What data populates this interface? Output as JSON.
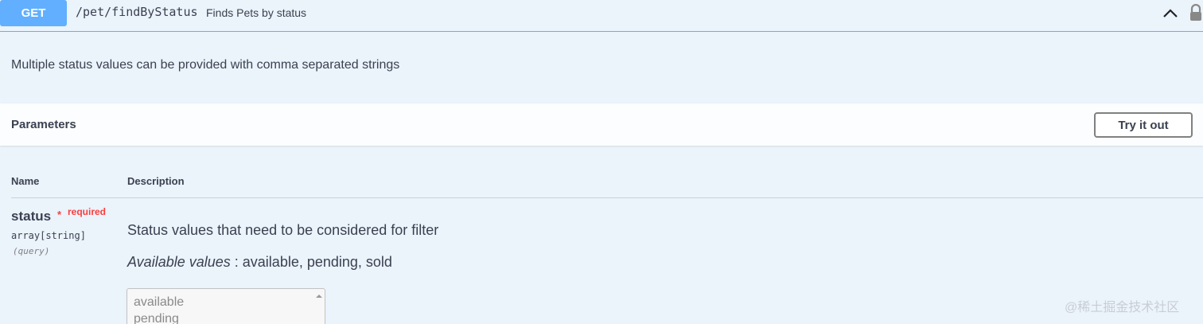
{
  "operation": {
    "method": "GET",
    "path": "/pet/findByStatus",
    "summary": "Finds Pets by status",
    "description": "Multiple status values can be provided with comma separated strings"
  },
  "parameters": {
    "title": "Parameters",
    "try_it_out_label": "Try it out",
    "columns": {
      "name": "Name",
      "description": "Description"
    },
    "items": [
      {
        "name": "status",
        "required_star": "*",
        "required_label": "required",
        "type": "array[string]",
        "in": "(query)",
        "description": "Status values that need to be considered for filter",
        "available_label": "Available values",
        "available_values": ": available, pending, sold",
        "options": [
          "available",
          "pending"
        ]
      }
    ]
  },
  "watermark": "@稀土掘金技术社区",
  "colors": {
    "accent": "#61affe",
    "required": "#f93e3e",
    "background": "#ebf3fb"
  }
}
